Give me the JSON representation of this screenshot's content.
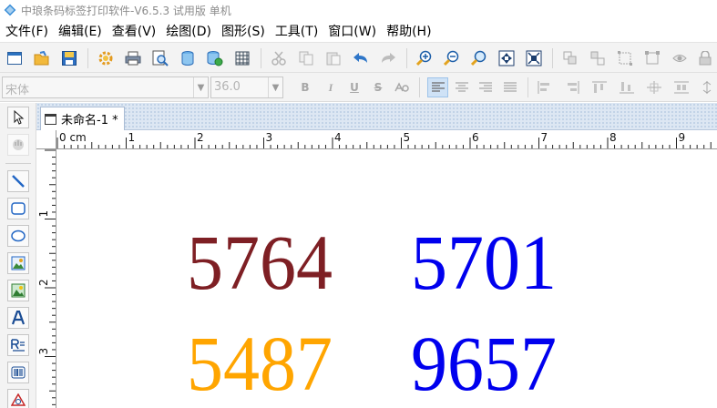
{
  "window": {
    "title": "中琅条码标签打印软件-V6.5.3 试用版 单机"
  },
  "menu": [
    {
      "label": "文件(F)"
    },
    {
      "label": "编辑(E)"
    },
    {
      "label": "查看(V)"
    },
    {
      "label": "绘图(D)"
    },
    {
      "label": "图形(S)"
    },
    {
      "label": "工具(T)"
    },
    {
      "label": "窗口(W)"
    },
    {
      "label": "帮助(H)"
    }
  ],
  "toolbar_icons": [
    "new-icon",
    "open-icon",
    "save-icon",
    "settings-icon",
    "print-icon",
    "print-preview-icon",
    "database-icon",
    "database-settings-icon",
    "grid-icon",
    "cut-icon",
    "copy-icon",
    "paste-icon",
    "undo-icon",
    "redo-icon",
    "zoom-in-icon",
    "zoom-out-icon",
    "zoom-icon",
    "fit-page-icon",
    "fit-selection-icon",
    "group-icon",
    "ungroup-icon",
    "select-frame-icon",
    "align-frame-icon",
    "visibility-icon",
    "lock-icon"
  ],
  "format": {
    "font_name": "宋体",
    "font_size": "36.0",
    "bold": "B",
    "italic": "I",
    "underline": "U",
    "strikethrough": "S"
  },
  "document": {
    "tab_label": "未命名-1 *"
  },
  "ruler": {
    "unit": "0 cm",
    "h_labels": [
      "1",
      "2",
      "3",
      "4",
      "5",
      "6",
      "7",
      "8",
      "9"
    ],
    "v_labels": [
      "1",
      "2",
      "3"
    ]
  },
  "canvas": {
    "numbers": [
      {
        "text": "5764",
        "color": "#7e1f24"
      },
      {
        "text": "5701",
        "color": "#0000ee"
      },
      {
        "text": "5487",
        "color": "#ffa500"
      },
      {
        "text": "9657",
        "color": "#0000ee"
      }
    ]
  }
}
